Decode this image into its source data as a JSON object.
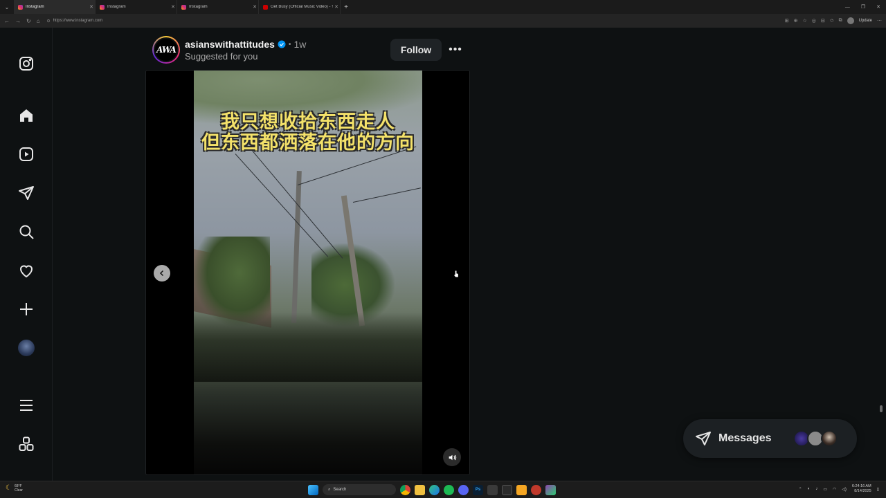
{
  "browser": {
    "tabs": [
      {
        "title": "Instagram",
        "icon": "instagram-icon",
        "active": true
      },
      {
        "title": "Instagram",
        "icon": "instagram-icon",
        "active": false
      },
      {
        "title": "Instagram",
        "icon": "instagram-icon",
        "active": false
      },
      {
        "title": "Get Busy (Official Music Video) - Y",
        "icon": "youtube-icon",
        "active": false
      }
    ],
    "url": "https://www.instagram.com",
    "update_label": "Update"
  },
  "post": {
    "username": "asianswithattitudes",
    "avatar_text": "AWA",
    "verified": true,
    "time": "1w",
    "dot": "•",
    "subtitle": "Suggested for you",
    "follow_label": "Follow",
    "more": "•••",
    "subtitles": [
      "我只想收拾东西走人",
      "但东西都洒落在他的方向"
    ]
  },
  "messages": {
    "label": "Messages"
  },
  "taskbar": {
    "weather_temp": "68°F",
    "weather_desc": "Clear",
    "search_placeholder": "Search",
    "time": "6:24:16 AM",
    "date": "8/14/2025"
  },
  "colors": {
    "accent": "#0095f6",
    "background": "#0e1112",
    "surface": "#1f2326"
  }
}
